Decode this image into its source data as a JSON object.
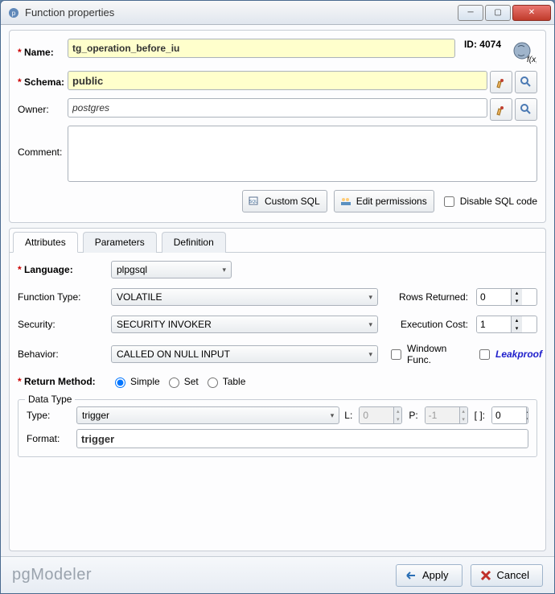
{
  "window": {
    "title": "Function properties"
  },
  "header": {
    "name_label": "Name:",
    "name_value": "tg_operation_before_iu",
    "id_label": "ID:",
    "id_value": "4074",
    "schema_label": "Schema:",
    "schema_value": "public",
    "owner_label": "Owner:",
    "owner_value": "postgres",
    "comment_label": "Comment:",
    "comment_value": ""
  },
  "toolbar": {
    "custom_sql": "Custom SQL",
    "edit_permissions": "Edit permissions",
    "disable_sql": "Disable SQL code"
  },
  "tabs": {
    "attributes": "Attributes",
    "parameters": "Parameters",
    "definition": "Definition"
  },
  "attributes": {
    "language_label": "Language:",
    "language_value": "plpgsql",
    "function_type_label": "Function Type:",
    "function_type_value": "VOLATILE",
    "rows_returned_label": "Rows Returned:",
    "rows_returned_value": "0",
    "security_label": "Security:",
    "security_value": "SECURITY INVOKER",
    "execution_cost_label": "Execution Cost:",
    "execution_cost_value": "1",
    "behavior_label": "Behavior:",
    "behavior_value": "CALLED ON NULL INPUT",
    "window_func_label": "Windown Func.",
    "leakproof_label": "Leakproof",
    "return_method_label": "Return Method:",
    "return_method_options": {
      "simple": "Simple",
      "set": "Set",
      "table": "Table"
    },
    "datatype_legend": "Data Type",
    "type_label": "Type:",
    "type_value": "trigger",
    "L_label": "L:",
    "L_value": "0",
    "P_label": "P:",
    "P_value": "-1",
    "brackets_label": "[ ]:",
    "brackets_value": "0",
    "format_label": "Format:",
    "format_value": "trigger"
  },
  "footer": {
    "brand": "pgModeler",
    "apply": "Apply",
    "cancel": "Cancel"
  }
}
